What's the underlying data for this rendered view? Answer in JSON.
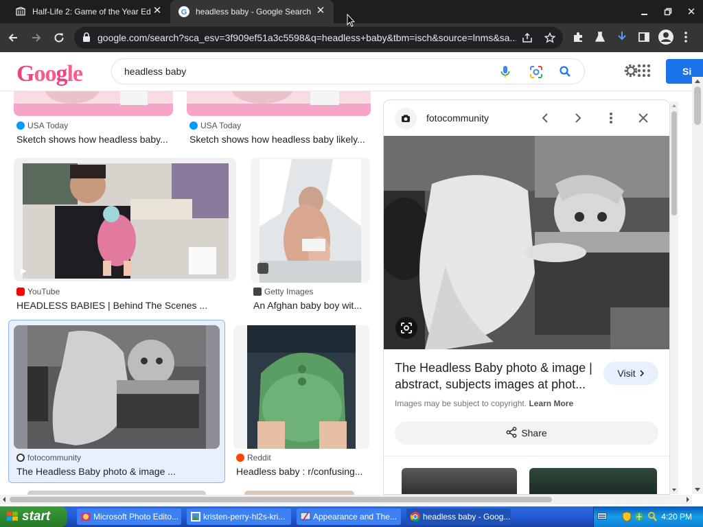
{
  "browser": {
    "tabs": [
      {
        "title": "Half-Life 2: Game of the Year Edition",
        "active": false,
        "icon": "steam-icon"
      },
      {
        "title": "headless baby - Google Search",
        "active": true,
        "icon": "google-icon"
      }
    ],
    "url": "google.com/search?sca_esv=3f909ef51a3c5598&q=headless+baby&tbm=isch&source=lnms&sa..."
  },
  "google": {
    "logo_text": "Google",
    "search_query": "headless baby",
    "signin_label": "Si"
  },
  "results": [
    {
      "source": "USA Today",
      "title": "Sketch shows how headless baby...",
      "icon": "usatoday-icon"
    },
    {
      "source": "USA Today",
      "title": "Sketch shows how headless baby likely...",
      "icon": "usatoday-icon"
    },
    {
      "source": "YouTube",
      "title": "HEADLESS BABIES | Behind The Scenes ...",
      "icon": "youtube-icon"
    },
    {
      "source": "Getty Images",
      "title": "An Afghan baby boy wit...",
      "icon": "getty-icon"
    },
    {
      "source": "fotocommunity",
      "title": "The Headless Baby photo & image ...",
      "icon": "fotocommunity-icon",
      "selected": true
    },
    {
      "source": "Reddit",
      "title": "Headless baby : r/confusing...",
      "icon": "reddit-icon"
    }
  ],
  "panel": {
    "site": "fotocommunity",
    "title": "The Headless Baby photo & image | abstract, subjects images at phot...",
    "visit_label": "Visit",
    "copyright_text": "Images may be subject to copyright.",
    "learn_more_label": "Learn More",
    "share_label": "Share"
  },
  "taskbar": {
    "start_label": "start",
    "buttons": [
      {
        "label": "Microsoft Photo Edito...",
        "active": false
      },
      {
        "label": "kristen-perry-hl2s-kri...",
        "active": false
      },
      {
        "label": "Appearance and The...",
        "active": false
      },
      {
        "label": "headless baby - Goog...",
        "active": true
      }
    ],
    "clock": "4:20 PM"
  },
  "colors": {
    "chrome_dark": "#1e1e1e",
    "chrome_toolbar": "#353535",
    "google_blue": "#1a73e8",
    "selected_bg": "#e8f0fe",
    "xp_taskbar": "#245edb",
    "xp_start": "#2f8a2f"
  }
}
